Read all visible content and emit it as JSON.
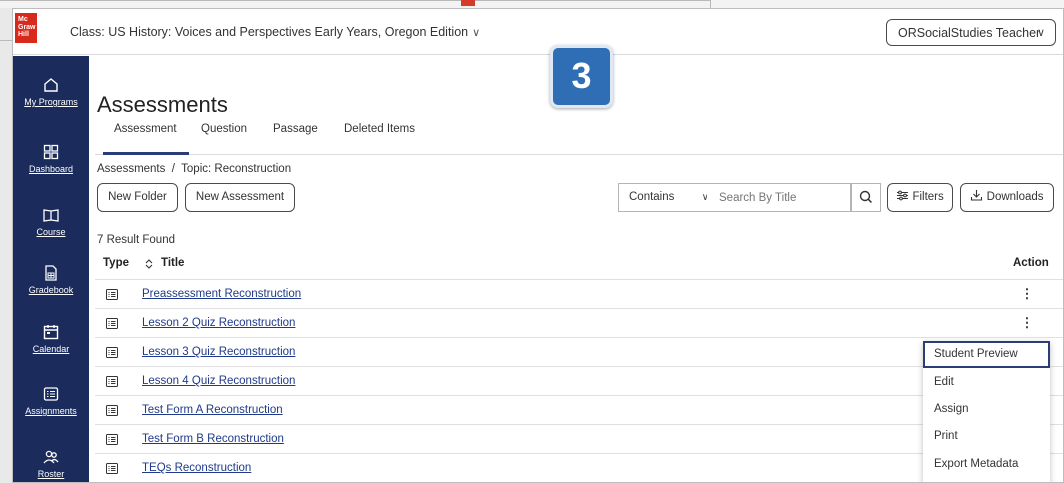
{
  "header": {
    "logo_lines": [
      "Mc",
      "Graw",
      "Hill"
    ],
    "class_title": "Class: US History: Voices and Perspectives Early Years, Oregon Edition",
    "user_button": "ORSocialStudies Teacher"
  },
  "step_badge": "3",
  "sidebar": {
    "items": [
      {
        "label": "My Programs",
        "icon": "home-icon"
      },
      {
        "label": "Dashboard",
        "icon": "dashboard-icon"
      },
      {
        "label": "Course",
        "icon": "book-icon"
      },
      {
        "label": "Gradebook",
        "icon": "gradebook-icon"
      },
      {
        "label": "Calendar",
        "icon": "calendar-icon"
      },
      {
        "label": "Assignments",
        "icon": "assignments-icon"
      },
      {
        "label": "Roster",
        "icon": "roster-icon"
      }
    ]
  },
  "main": {
    "page_title": "Assessments",
    "tabs": [
      {
        "label": "Assessment",
        "active": true
      },
      {
        "label": "Question"
      },
      {
        "label": "Passage"
      },
      {
        "label": "Deleted Items"
      }
    ],
    "breadcrumb": "Assessments  /  Topic: Reconstruction",
    "toolbar": {
      "new_folder": "New Folder",
      "new_assessment": "New Assessment",
      "contains": "Contains",
      "search_placeholder": "Search By Title",
      "filters": "Filters",
      "downloads": "Downloads"
    },
    "results_count": "7 Result Found",
    "columns": {
      "type": "Type",
      "title": "Title",
      "action": "Action"
    },
    "rows": [
      {
        "title": "Preassessment Reconstruction",
        "kebab": true
      },
      {
        "title": "Lesson 2 Quiz Reconstruction",
        "kebab": true
      },
      {
        "title": "Lesson 3 Quiz Reconstruction"
      },
      {
        "title": "Lesson 4 Quiz Reconstruction"
      },
      {
        "title": "Test Form A Reconstruction"
      },
      {
        "title": "Test Form B Reconstruction"
      },
      {
        "title": "TEQs Reconstruction"
      }
    ],
    "action_menu": [
      "Student Preview",
      "Edit",
      "Assign",
      "Print",
      "Export Metadata"
    ]
  }
}
